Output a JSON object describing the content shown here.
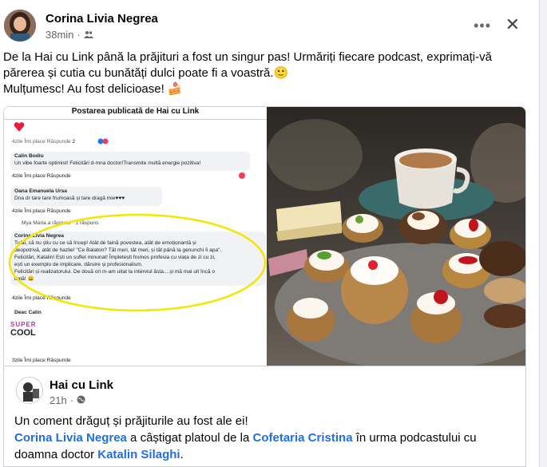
{
  "post": {
    "author": "Corina Livia Negrea",
    "time": "38min",
    "audience_icon": "friends-icon",
    "more_label": "•••",
    "close_label": "✕",
    "text_line1": "De la Hai cu Link până la prăjituri a fost un singur pas! Urmăriți fiecare podcast, exprimați-vă",
    "text_line2": "părerea și cutia cu bunătăți dulci poate fi a voastră.🙂",
    "text_line3": "Mulțumesc! Au fost delicioase! 🍰"
  },
  "embedded": {
    "title": "Postarea publicată de Hai cu Link",
    "c1_meta": "4zile   Îmi place   Răspunde",
    "c1_count": "2",
    "c2_author": "Calin Bodiu",
    "c2_text": "Un vibe foarte optimist! Felicitări d-mna doctor!Transmite multă energie pozitiva!",
    "c2_meta": "4zile   Îmi place   Răspunde",
    "c3_author": "Oana Emanuela Ursa",
    "c3_text": "Dna dr tare tare frumoasă și tare dragă mie♥♥♥",
    "c3_meta": "4zile   Îmi place   Răspunde",
    "reply_line": "Mya Maria a răspuns · 1 răspuns",
    "c4_author": "Corina Livia Negrea",
    "c4_l1": "Tulai, că nu știu cu ce să încep! Atât de faină povestea, atât de emoționantă și",
    "c4_l2": "deopotrivă, atât de hazlie! \"Ce Balaton? Tăt meri, tăt meri, și tăt până la genunchi îi apa\".",
    "c4_l3": "Felicitări, Katalin! Ești un suflet minunat! Împletești frumos profesia cu viața de zi cu zi,",
    "c4_l4": "ești un exemplu de implicare, dăruire și profesionalism.",
    "c4_l5": "Felicitări și realizatorului. De două ori m-am uitat la interviul ăsta....și mă mai uit încă o",
    "c4_l6": "dată! 😀",
    "c4_meta": "4zile   Îmi place   Răspunde",
    "c5_author": "Deac Calin",
    "sticker_l1": "SUPER",
    "sticker_l2": "COOL",
    "c5_meta": "3zile   Îmi place   Răspunde"
  },
  "shared": {
    "page_name": "Hai cu Link",
    "time": "21h",
    "audience_icon": "globe-icon",
    "text_line1": "Un coment drăguț și prăjiturile au fost ale ei!",
    "mention1": "Corina Livia Negrea",
    "mid1": " a câștigat platoul de la ",
    "mention2": "Cofetaria Cristina",
    "mid2": " în urma podcastului cu",
    "line3_start": "doamna doctor ",
    "mention3": "Katalin Silaghi",
    "end": "."
  },
  "colors": {
    "link": "#216fdb",
    "meta": "#65676b"
  }
}
